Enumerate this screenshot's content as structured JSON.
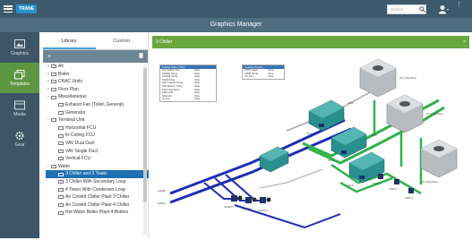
{
  "app": {
    "logo_text": "TRANE",
    "title": "Graphics Manager",
    "search_placeholder": "Search",
    "brand_blue": "#2a8fcf",
    "header_bg": "#3d5a6c",
    "accent_green": "#6aa83f"
  },
  "sidebar": {
    "items": [
      {
        "label": "Graphics",
        "icon": "image-icon"
      },
      {
        "label": "Templates",
        "icon": "templates-icon"
      },
      {
        "label": "Media",
        "icon": "media-icon"
      },
      {
        "label": "Gear",
        "icon": "gear-icon"
      }
    ]
  },
  "left_panel": {
    "tabs": [
      "Library",
      "Custom"
    ],
    "tree": [
      {
        "label": "Air",
        "toggle": "+",
        "level": 0
      },
      {
        "label": "Boiler",
        "toggle": "+",
        "level": 0
      },
      {
        "label": "CRAC Units",
        "toggle": "+",
        "level": 0
      },
      {
        "label": "Floor Plan",
        "toggle": "+",
        "level": 0
      },
      {
        "label": "Miscellaneous",
        "toggle": "−",
        "level": 0
      },
      {
        "label": "Exhaust Fan (Toilet, General)",
        "toggle": "",
        "level": 1
      },
      {
        "label": "Generator",
        "toggle": "",
        "level": 1
      },
      {
        "label": "Terminal Unit",
        "toggle": "−",
        "level": 0
      },
      {
        "label": "Horizontal FCU",
        "toggle": "",
        "level": 1
      },
      {
        "label": "In-Ceiling FCU",
        "toggle": "",
        "level": 1
      },
      {
        "label": "VAV Dual Duct",
        "toggle": "",
        "level": 1
      },
      {
        "label": "VAV Single Duct",
        "toggle": "",
        "level": 1
      },
      {
        "label": "Vertical FCU",
        "toggle": "",
        "level": 1
      },
      {
        "label": "Water",
        "toggle": "−",
        "level": 0
      },
      {
        "label": "3 Chiller and 3 Tower",
        "toggle": "",
        "level": 1,
        "selected": true
      },
      {
        "label": "3 Chiller With Secondary Loop",
        "toggle": "",
        "level": 1
      },
      {
        "label": "4 Tower With Condenser Loop",
        "toggle": "",
        "level": 1
      },
      {
        "label": "Air Cooled Chiller Plant 3 Chiller",
        "toggle": "",
        "level": 1
      },
      {
        "label": "Air Cooled Chiller Plant 4 Chiller",
        "toggle": "",
        "level": 1
      },
      {
        "label": "Hot Water Boiler Plant 4 Boilers",
        "toggle": "",
        "level": 1
      }
    ]
  },
  "main": {
    "header_label": "3 Chiller",
    "tables": [
      {
        "title": "Chilled Water Plant",
        "rows": [
          [
            "CH Status Run",
            "Stop"
          ],
          [
            "CHWS Temp",
            "Stop"
          ],
          [
            "CHWR Temp",
            "Stop"
          ],
          [
            "CHW Flow",
            "Stop"
          ],
          [
            "CW Supply Temp",
            "Stop"
          ],
          [
            "CW Return Temp",
            "Stop"
          ],
          [
            "Plant Demand",
            "Stop"
          ],
          [
            "Plant kW",
            "Stop"
          ],
          [
            "Setpoint",
            "Stop"
          ],
          [
            "Comm",
            "Stop"
          ]
        ]
      },
      {
        "title": "Cooling Towers",
        "rows": [
          [
            "CWS Setpt",
            "Stop"
          ],
          [
            "CWR Temp",
            "Stop"
          ],
          [
            "CT Fan",
            "Stop"
          ]
        ]
      }
    ],
    "labels": [
      "CHWR",
      "CHWS",
      "CWS",
      "CWR",
      "CT-1 Run/Stop",
      "CT-2 Run/Stop",
      "CT-3 Run/Stop",
      "CH-1",
      "CH-2",
      "CH-3",
      "CHWP-1",
      "CHWP-2",
      "CHWP-3",
      "CWP-1",
      "CWP-2",
      "CWP-3"
    ]
  }
}
